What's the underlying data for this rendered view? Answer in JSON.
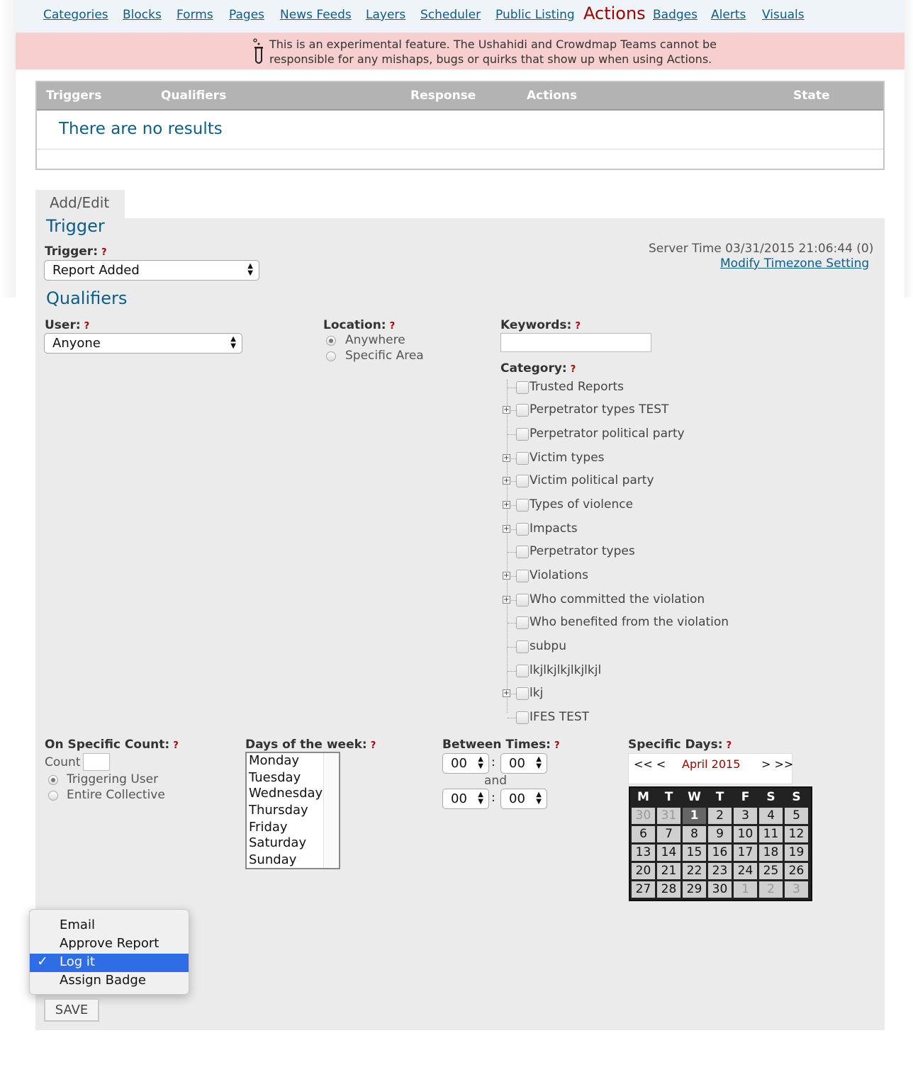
{
  "nav": {
    "items": [
      "Categories",
      "Blocks",
      "Forms",
      "Pages",
      "News Feeds",
      "Layers",
      "Scheduler",
      "Public Listing"
    ],
    "active": "Actions",
    "after": [
      "Badges",
      "Alerts",
      "Visuals"
    ]
  },
  "warning": {
    "line1": "This is an experimental feature. The Ushahidi and Crowdmap Teams cannot be",
    "line2": "responsible for any mishaps, bugs or quirks that show up when using Actions."
  },
  "results": {
    "columns": [
      "Triggers",
      "Qualifiers",
      "Response",
      "Actions",
      "State"
    ],
    "empty": "There are no results"
  },
  "tab": "Add/Edit",
  "trigger": {
    "heading": "Trigger",
    "label": "Trigger:",
    "help": "?",
    "value": "Report Added",
    "server_time": "Server Time 03/31/2015 21:06:44 (0)",
    "timezone_link": "Modify Timezone Setting"
  },
  "qualifiers": {
    "heading": "Qualifiers",
    "user_label": "User:",
    "user_value": "Anyone",
    "location_label": "Location:",
    "location_options": [
      "Anywhere",
      "Specific Area"
    ],
    "location_selected": "Anywhere",
    "keywords_label": "Keywords:",
    "keywords_value": "",
    "category_label": "Category:",
    "categories": [
      {
        "name": "Trusted Reports",
        "expandable": false
      },
      {
        "name": "Perpetrator types TEST",
        "expandable": true
      },
      {
        "name": "Perpetrator political party",
        "expandable": false
      },
      {
        "name": "Victim types",
        "expandable": true
      },
      {
        "name": "Victim political party",
        "expandable": true
      },
      {
        "name": "Types of violence",
        "expandable": true
      },
      {
        "name": "Impacts",
        "expandable": true
      },
      {
        "name": "Perpetrator types",
        "expandable": false
      },
      {
        "name": "Violations",
        "expandable": true
      },
      {
        "name": "Who committed the violation",
        "expandable": true
      },
      {
        "name": "Who benefited from the violation",
        "expandable": false
      },
      {
        "name": "subpu",
        "expandable": false
      },
      {
        "name": "lkjlkjlkjlkjlkjl",
        "expandable": false
      },
      {
        "name": "lkj",
        "expandable": true
      },
      {
        "name": "IFES TEST",
        "expandable": false
      }
    ]
  },
  "count": {
    "label": "On Specific Count:",
    "count_label": "Count",
    "count_value": "",
    "options": [
      "Triggering User",
      "Entire Collective"
    ],
    "selected": "Triggering User"
  },
  "days": {
    "label": "Days of the week:",
    "items": [
      "Monday",
      "Tuesday",
      "Wednesday",
      "Thursday",
      "Friday",
      "Saturday",
      "Sunday"
    ]
  },
  "times": {
    "label": "Between Times:",
    "from_h": "00",
    "from_m": "00",
    "and": "and",
    "to_h": "00",
    "to_m": "00",
    "sep": ":"
  },
  "specific_days": {
    "label": "Specific Days:",
    "prev": "<< <",
    "month": "April 2015",
    "next": "> >>",
    "weekdays": [
      "M",
      "T",
      "W",
      "T",
      "F",
      "S",
      "S"
    ],
    "weeks": [
      [
        "30",
        "31",
        "1",
        "2",
        "3",
        "4",
        "5"
      ],
      [
        "6",
        "7",
        "8",
        "9",
        "10",
        "11",
        "12"
      ],
      [
        "13",
        "14",
        "15",
        "16",
        "17",
        "18",
        "19"
      ],
      [
        "20",
        "21",
        "22",
        "23",
        "24",
        "25",
        "26"
      ],
      [
        "27",
        "28",
        "29",
        "30",
        "1",
        "2",
        "3"
      ]
    ],
    "month_color": "#a30000"
  },
  "response_menu": {
    "options": [
      "Email",
      "Approve Report",
      "Log it",
      "Assign Badge"
    ],
    "selected": "Log it",
    "check": "✓"
  },
  "save": "SAVE",
  "colors": {
    "link": "#0b5e8a",
    "active_nav": "#a30000",
    "warning_bg": "#f7cfcf",
    "help": "#b00000",
    "menu_highlight": "#2f6de6"
  }
}
